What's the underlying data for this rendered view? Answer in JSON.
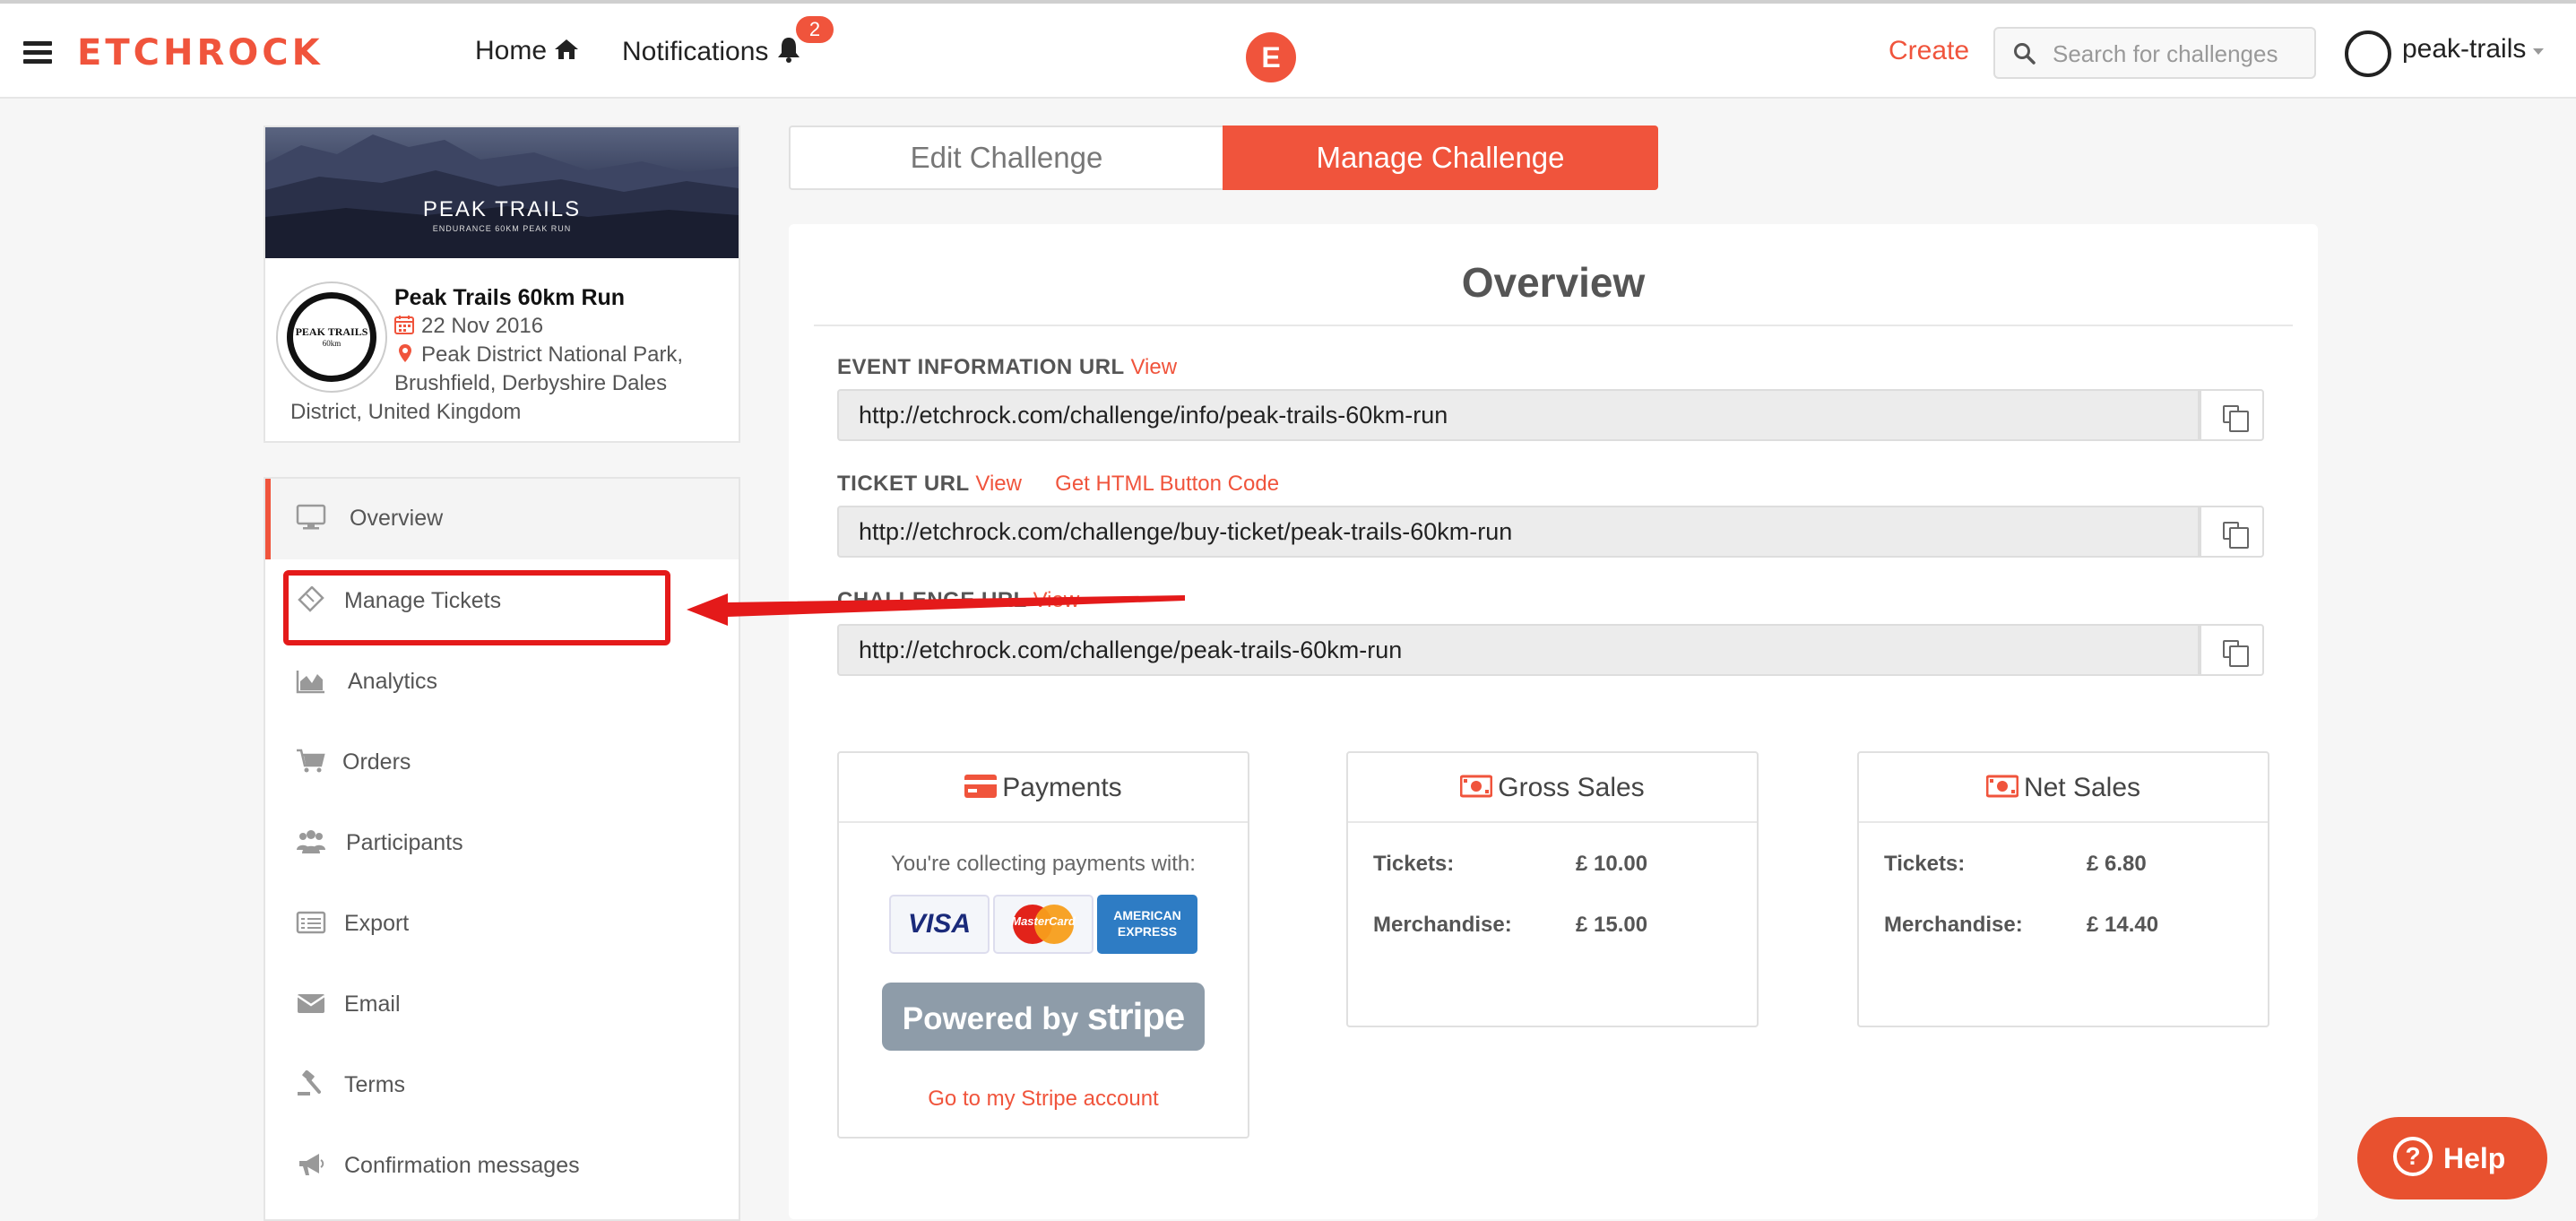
{
  "header": {
    "logo": "ETCHROCK",
    "nav": {
      "home": "Home",
      "notifications": "Notifications",
      "notifications_count": "2"
    },
    "center_logo": "E",
    "create": "Create",
    "search_placeholder": "Search for challenges",
    "username": "peak-trails"
  },
  "event": {
    "banner_title": "PEAK TRAILS",
    "banner_subtitle": "ENDURANCE 60KM PEAK RUN",
    "logo_text": "PEAK TRAILS",
    "logo_sub": "60km",
    "name": "Peak Trails 60km Run",
    "date": "22 Nov 2016",
    "location_line1": "Peak District National Park,",
    "location_line2": "Brushfield, Derbyshire Dales",
    "location_line3": "District, United Kingdom"
  },
  "sidebar": {
    "items": [
      {
        "label": "Overview",
        "icon": "monitor-icon",
        "active": true
      },
      {
        "label": "Manage Tickets",
        "icon": "ticket-icon"
      },
      {
        "label": "Analytics",
        "icon": "area-chart-icon"
      },
      {
        "label": "Orders",
        "icon": "cart-icon"
      },
      {
        "label": "Participants",
        "icon": "users-icon"
      },
      {
        "label": "Export",
        "icon": "list-icon"
      },
      {
        "label": "Email",
        "icon": "envelope-icon"
      },
      {
        "label": "Terms",
        "icon": "gavel-icon"
      },
      {
        "label": "Confirmation messages",
        "icon": "megaphone-icon"
      }
    ]
  },
  "tabs": {
    "edit": "Edit Challenge",
    "manage": "Manage Challenge"
  },
  "overview": {
    "title": "Overview",
    "event_info": {
      "label": "EVENT INFORMATION URL",
      "view": "View",
      "url": "http://etchrock.com/challenge/info/peak-trails-60km-run"
    },
    "ticket": {
      "label": "TICKET URL",
      "view": "View",
      "html_button": "Get HTML Button Code",
      "url": "http://etchrock.com/challenge/buy-ticket/peak-trails-60km-run"
    },
    "challenge": {
      "label": "CHALLENGE URL",
      "view": "View",
      "url": "http://etchrock.com/challenge/peak-trails-60km-run"
    }
  },
  "payments": {
    "title": "Payments",
    "collecting_text": "You're collecting payments with:",
    "cards": [
      "VISA",
      "MasterCard",
      "AMERICAN EXPRESS"
    ],
    "stripe_prefix": "Powered by",
    "stripe_brand": "stripe",
    "stripe_link": "Go to my Stripe account"
  },
  "gross_sales": {
    "title": "Gross Sales",
    "tickets_label": "Tickets:",
    "tickets_value": "£ 10.00",
    "merch_label": "Merchandise:",
    "merch_value": "£ 15.00"
  },
  "net_sales": {
    "title": "Net Sales",
    "tickets_label": "Tickets:",
    "tickets_value": "£ 6.80",
    "merch_label": "Merchandise:",
    "merch_value": "£ 14.40"
  },
  "help": {
    "label": "Help",
    "icon": "?"
  },
  "colors": {
    "accent": "#f0543c",
    "annotation": "#e41a1a"
  }
}
